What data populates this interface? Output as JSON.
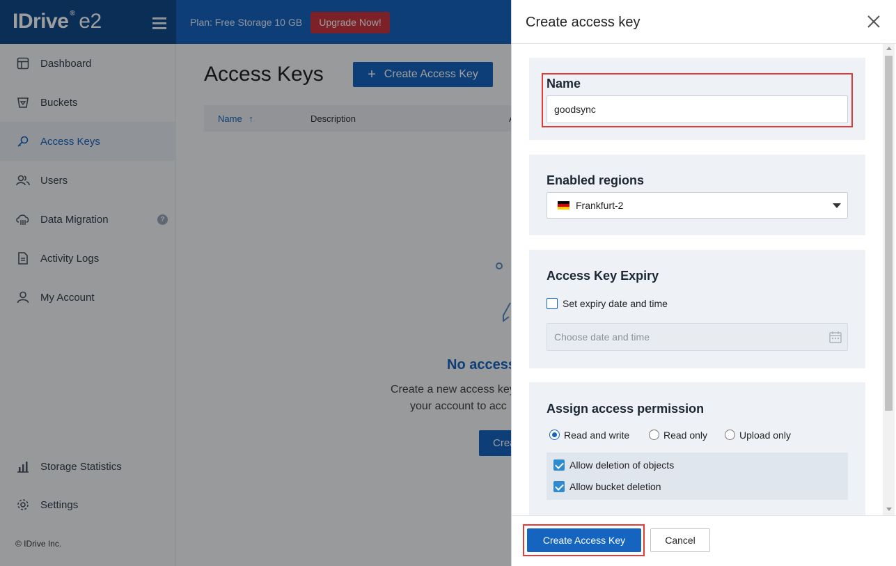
{
  "header": {
    "logo": "IDrive",
    "logo_suffix": "e2",
    "logo_reg": "®",
    "plan_text": "Plan: Free Storage 10 GB",
    "upgrade_label": "Upgrade Now!"
  },
  "sidebar": {
    "items": [
      {
        "label": "Dashboard",
        "icon": "dashboard-icon"
      },
      {
        "label": "Buckets",
        "icon": "bucket-icon"
      },
      {
        "label": "Access Keys",
        "icon": "key-icon",
        "active": true
      },
      {
        "label": "Users",
        "icon": "users-icon"
      },
      {
        "label": "Data Migration",
        "icon": "cloud-migration-icon",
        "help": "?"
      },
      {
        "label": "Activity Logs",
        "icon": "document-icon"
      },
      {
        "label": "My Account",
        "icon": "user-icon"
      },
      {
        "label": "Storage Statistics",
        "icon": "bar-chart-icon"
      },
      {
        "label": "Settings",
        "icon": "gear-icon"
      }
    ],
    "copyright": "© IDrive Inc."
  },
  "main": {
    "title": "Access Keys",
    "create_button": "Create Access Key",
    "plus": "+",
    "table": {
      "col_name": "Name",
      "sort_arrow": "↑",
      "col_description": "Description",
      "col_partial": "A"
    },
    "empty": {
      "title": "No access",
      "line1": "Create a new access key",
      "line2": "your account to acc",
      "button": "Crea"
    }
  },
  "dialog": {
    "title": "Create access key",
    "name_section": {
      "label": "Name",
      "value": "goodsync"
    },
    "regions_section": {
      "label": "Enabled regions",
      "selected": "Frankfurt-2",
      "flag_colors": [
        "#000000",
        "#dd0000",
        "#ffce00"
      ]
    },
    "expiry_section": {
      "label": "Access Key Expiry",
      "checkbox_label": "Set expiry date and time",
      "checked": false,
      "date_placeholder": "Choose date and time"
    },
    "permission_section": {
      "label": "Assign access permission",
      "options": [
        {
          "label": "Read and write",
          "selected": true
        },
        {
          "label": "Read only",
          "selected": false
        },
        {
          "label": "Upload only",
          "selected": false
        }
      ],
      "checkboxes": [
        {
          "label": "Allow deletion of objects",
          "checked": true
        },
        {
          "label": "Allow bucket deletion",
          "checked": true
        }
      ]
    },
    "footer": {
      "create_label": "Create Access Key",
      "cancel_label": "Cancel"
    }
  },
  "colors": {
    "brand_blue": "#1565c0",
    "upgrade_red": "#c73640",
    "highlight_red": "#e53935"
  }
}
